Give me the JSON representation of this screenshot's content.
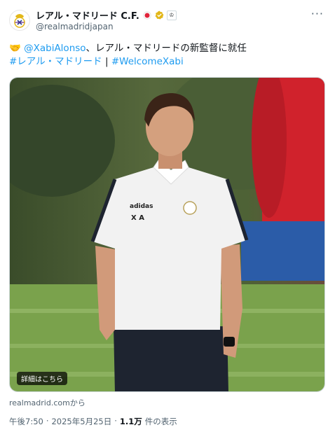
{
  "author": {
    "display_name": "レアル・マドリード C.F.",
    "handle": "@realmadridjapan",
    "flag_emoji": "🇯🇵"
  },
  "menu_icon": "more-dots-icon",
  "tweet": {
    "emoji": "🤝",
    "mention": "@XabiAlonso",
    "text": "、レアル・マドリードの新監督に就任",
    "hashtag1": "#レアル・マドリード",
    "separator": " | ",
    "hashtag2": "#WelcomeXabi"
  },
  "media": {
    "card_label": "詳細はこちら",
    "shirt_initials": "X A",
    "shirt_brand": "adidas"
  },
  "source": {
    "domain": "realmadrid.com",
    "suffix": "から"
  },
  "meta": {
    "time": "午後7:50",
    "dot": "·",
    "date": "2025年5月25日",
    "dot2": "·",
    "views": "1.1万",
    "views_label": "件の表示"
  },
  "colors": {
    "link": "#1d9bf0",
    "text": "#0f1419",
    "muted": "#536471",
    "verified": "#e2b719"
  }
}
